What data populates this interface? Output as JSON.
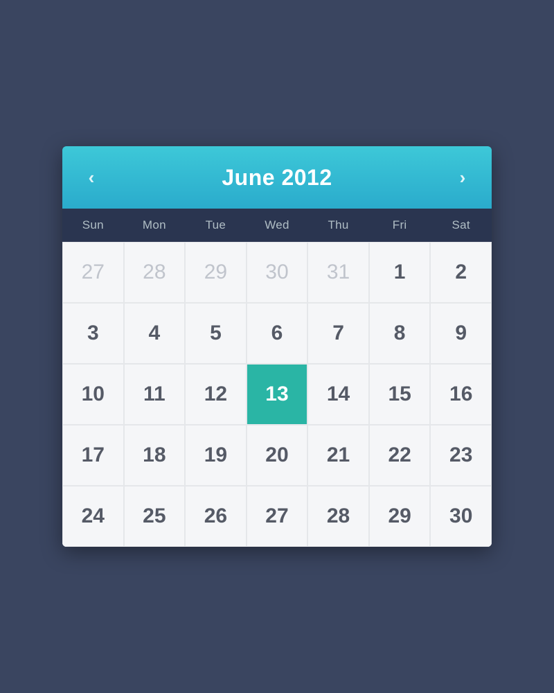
{
  "header": {
    "title": "June 2012",
    "prev_label": "‹",
    "next_label": "›"
  },
  "day_labels": [
    "Sun",
    "Mon",
    "Tue",
    "Wed",
    "Thu",
    "Fri",
    "Sat"
  ],
  "weeks": [
    [
      {
        "day": "27",
        "type": "prev-month"
      },
      {
        "day": "28",
        "type": "prev-month"
      },
      {
        "day": "29",
        "type": "prev-month"
      },
      {
        "day": "30",
        "type": "prev-month"
      },
      {
        "day": "31",
        "type": "prev-month"
      },
      {
        "day": "1",
        "type": "current"
      },
      {
        "day": "2",
        "type": "current"
      }
    ],
    [
      {
        "day": "3",
        "type": "current"
      },
      {
        "day": "4",
        "type": "current"
      },
      {
        "day": "5",
        "type": "current"
      },
      {
        "day": "6",
        "type": "current"
      },
      {
        "day": "7",
        "type": "current"
      },
      {
        "day": "8",
        "type": "current"
      },
      {
        "day": "9",
        "type": "current"
      }
    ],
    [
      {
        "day": "10",
        "type": "current"
      },
      {
        "day": "11",
        "type": "current"
      },
      {
        "day": "12",
        "type": "current"
      },
      {
        "day": "13",
        "type": "selected"
      },
      {
        "day": "14",
        "type": "current"
      },
      {
        "day": "15",
        "type": "current"
      },
      {
        "day": "16",
        "type": "current"
      }
    ],
    [
      {
        "day": "17",
        "type": "current"
      },
      {
        "day": "18",
        "type": "current"
      },
      {
        "day": "19",
        "type": "current"
      },
      {
        "day": "20",
        "type": "current"
      },
      {
        "day": "21",
        "type": "current"
      },
      {
        "day": "22",
        "type": "current"
      },
      {
        "day": "23",
        "type": "current"
      }
    ],
    [
      {
        "day": "24",
        "type": "current"
      },
      {
        "day": "25",
        "type": "current"
      },
      {
        "day": "26",
        "type": "current"
      },
      {
        "day": "27",
        "type": "current"
      },
      {
        "day": "28",
        "type": "current"
      },
      {
        "day": "29",
        "type": "current"
      },
      {
        "day": "30",
        "type": "current"
      }
    ]
  ]
}
